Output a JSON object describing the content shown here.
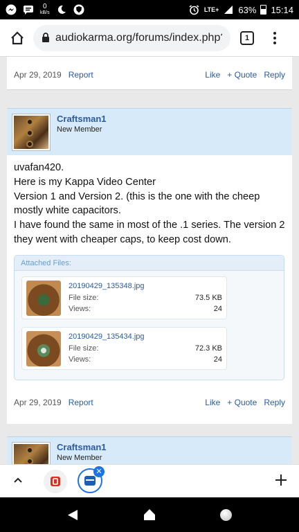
{
  "status_bar": {
    "net_speed": "0",
    "net_unit": "kB/s",
    "lte": "LTE+",
    "battery": "63%",
    "time": "15:14"
  },
  "browser": {
    "url": "audiokarma.org/forums/index.php?thre",
    "tab_count": "1"
  },
  "prev_post_footer": {
    "date": "Apr 29, 2019",
    "report": "Report",
    "like": "Like",
    "quote": "+ Quote",
    "reply": "Reply"
  },
  "post1": {
    "username": "Craftsman1",
    "user_title": "New Member",
    "message_lines": [
      "uvafan420.",
      "Here is my Kappa Video Center",
      "Version 1 and Version 2. (this is the one with the cheep mostly white capacitors.",
      "I have found the same in most of the .1 series. The version 2 they went with cheaper caps, to keep cost down."
    ],
    "attached_files_label": "Attached Files:",
    "files": [
      {
        "name": "20190429_135348.jpg",
        "size_label": "File size:",
        "size": "73.5 KB",
        "views_label": "Views:",
        "views": "24"
      },
      {
        "name": "20190429_135434.jpg",
        "size_label": "File size:",
        "size": "72.3 KB",
        "views_label": "Views:",
        "views": "24"
      }
    ],
    "footer": {
      "date": "Apr 29, 2019",
      "report": "Report",
      "like": "Like",
      "quote": "+ Quote",
      "reply": "Reply"
    }
  },
  "post2": {
    "username": "Craftsman1",
    "user_title": "New Member"
  },
  "icons": {
    "status": [
      "messenger-icon",
      "message-icon",
      "moon-icon",
      "shield-icon",
      "alarm-icon",
      "signal-icon",
      "battery-icon"
    ],
    "browser": [
      "home-icon",
      "lock-icon",
      "tab-switcher-icon",
      "menu-icon"
    ],
    "bottom": [
      "chevron-up-icon",
      "tab-thumbnail-icon",
      "close-icon",
      "plus-icon"
    ],
    "nav": [
      "back-icon",
      "home-icon",
      "recents-icon"
    ]
  },
  "colors": {
    "link": "#2c5aa0",
    "user_header": "#d7eaf9",
    "accent": "#1a73e8"
  }
}
